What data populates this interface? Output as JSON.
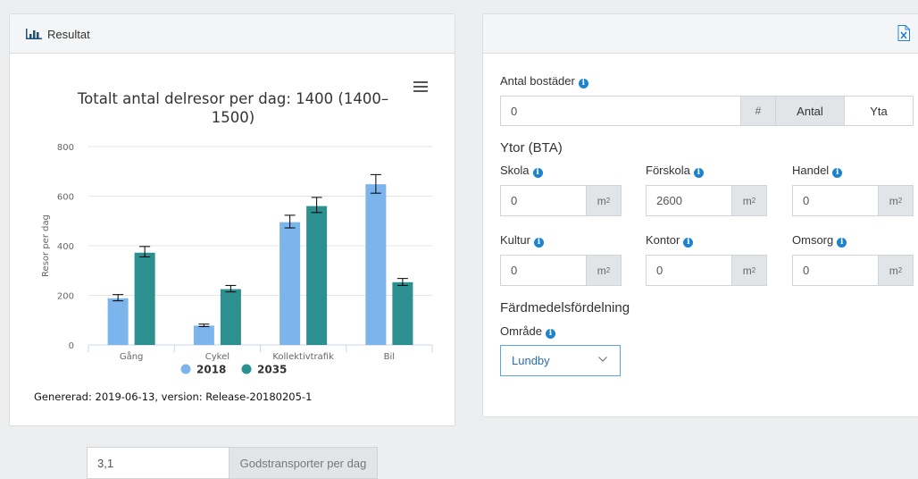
{
  "left_panel": {
    "header_title": "Resultat",
    "generated_text": "Genererad: 2019-06-13, version: Release-20180205-1"
  },
  "chart_data": {
    "type": "bar",
    "title_line1": "Totalt antal delresor per dag: 1400 (1400–",
    "title_line2": "1500)",
    "ylabel": "Resor per dag",
    "xlabel": "",
    "ylim": [
      0,
      800
    ],
    "yticks": [
      "0",
      "200",
      "400",
      "600",
      "800"
    ],
    "categories": [
      "Gång",
      "Cykel",
      "Kollektivtrafik",
      "Bil"
    ],
    "series": [
      {
        "name": "2018",
        "color": "#7cb5ec",
        "values": [
          188,
          78,
          495,
          648
        ],
        "error_low": [
          178,
          74,
          472,
          612
        ],
        "error_high": [
          203,
          84,
          523,
          687
        ]
      },
      {
        "name": "2035",
        "color": "#2b908f",
        "values": [
          372,
          225,
          560,
          253
        ],
        "error_low": [
          355,
          214,
          534,
          240
        ],
        "error_high": [
          397,
          240,
          595,
          268
        ]
      }
    ],
    "legend_position": "bottom-center",
    "grid": true
  },
  "right_panel": {
    "antal_bostader_label": "Antal bostäder",
    "antal_bostader_value": "0",
    "hash_addon": "#",
    "btn_antal": "Antal",
    "btn_yta": "Yta",
    "ytor_title": "Ytor (BTA)",
    "unit": "m",
    "unit_sup": "2",
    "fields": [
      {
        "label": "Skola",
        "value": "0"
      },
      {
        "label": "Förskola",
        "value": "2600"
      },
      {
        "label": "Handel",
        "value": "0"
      },
      {
        "label": "Kultur",
        "value": "0"
      },
      {
        "label": "Kontor",
        "value": "0"
      },
      {
        "label": "Omsorg",
        "value": "0"
      }
    ],
    "fardmedel_title": "Färdmedelsfördelning",
    "omrade_label": "Område",
    "omrade_value": "Lundby"
  },
  "bottom": {
    "gods_value": "3,1",
    "gods_label": "Godstransporter per dag"
  },
  "info_glyph": "i"
}
